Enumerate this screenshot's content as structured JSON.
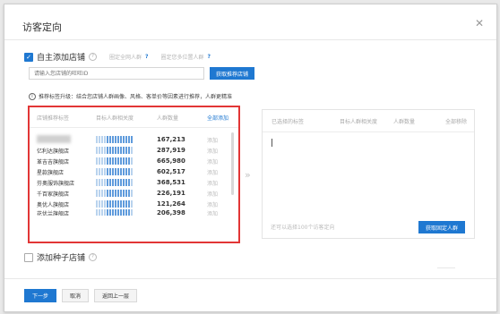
{
  "dialog": {
    "title": "访客定向"
  },
  "own_shop": {
    "label": "自主添加店铺",
    "link1": "圈定全网人群",
    "link2": "圈定您多位置人群"
  },
  "search": {
    "placeholder": "请输入您店铺的旺旺ID",
    "button": "获取推荐店铺"
  },
  "tip": "推荐标签升级：结合您店铺人群画像、风格、客单价等因素进行推荐，人群更精准",
  "left_table": {
    "headers": [
      "店铺推荐标签",
      "目标人群相关度",
      "人群数量",
      "全部添加"
    ],
    "rows": [
      {
        "name": "",
        "level": 1.0,
        "count": "167,213",
        "op": "添加"
      },
      {
        "name": "亿利达旗舰店",
        "level": 0.9,
        "count": "287,919",
        "op": "添加"
      },
      {
        "name": "革吉吉旗舰店",
        "level": 0.9,
        "count": "665,980",
        "op": "添加"
      },
      {
        "name": "星款旗舰店",
        "level": 0.9,
        "count": "602,517",
        "op": "添加"
      },
      {
        "name": "芬奥服饰旗舰店",
        "level": 0.9,
        "count": "368,531",
        "op": "添加"
      },
      {
        "name": "千百家旗舰店",
        "level": 0.9,
        "count": "226,191",
        "op": "添加"
      },
      {
        "name": "奥优人旗舰店",
        "level": 0.9,
        "count": "121,264",
        "op": "添加"
      },
      {
        "name": "花优兰旗舰店",
        "level": 0.9,
        "count": "206,398",
        "op": "添加"
      }
    ]
  },
  "transfer_arrow": "»",
  "right_table": {
    "headers": [
      "已选择的标签",
      "目标人群相关度",
      "人群数量",
      "全部移除"
    ],
    "footer": "还可以选择100个访客定向",
    "button": "获取固定人群"
  },
  "seed_shop": {
    "label": "添加种子店铺"
  },
  "footer": {
    "next": "下一步",
    "cancel": "取消",
    "back": "返回上一层"
  }
}
